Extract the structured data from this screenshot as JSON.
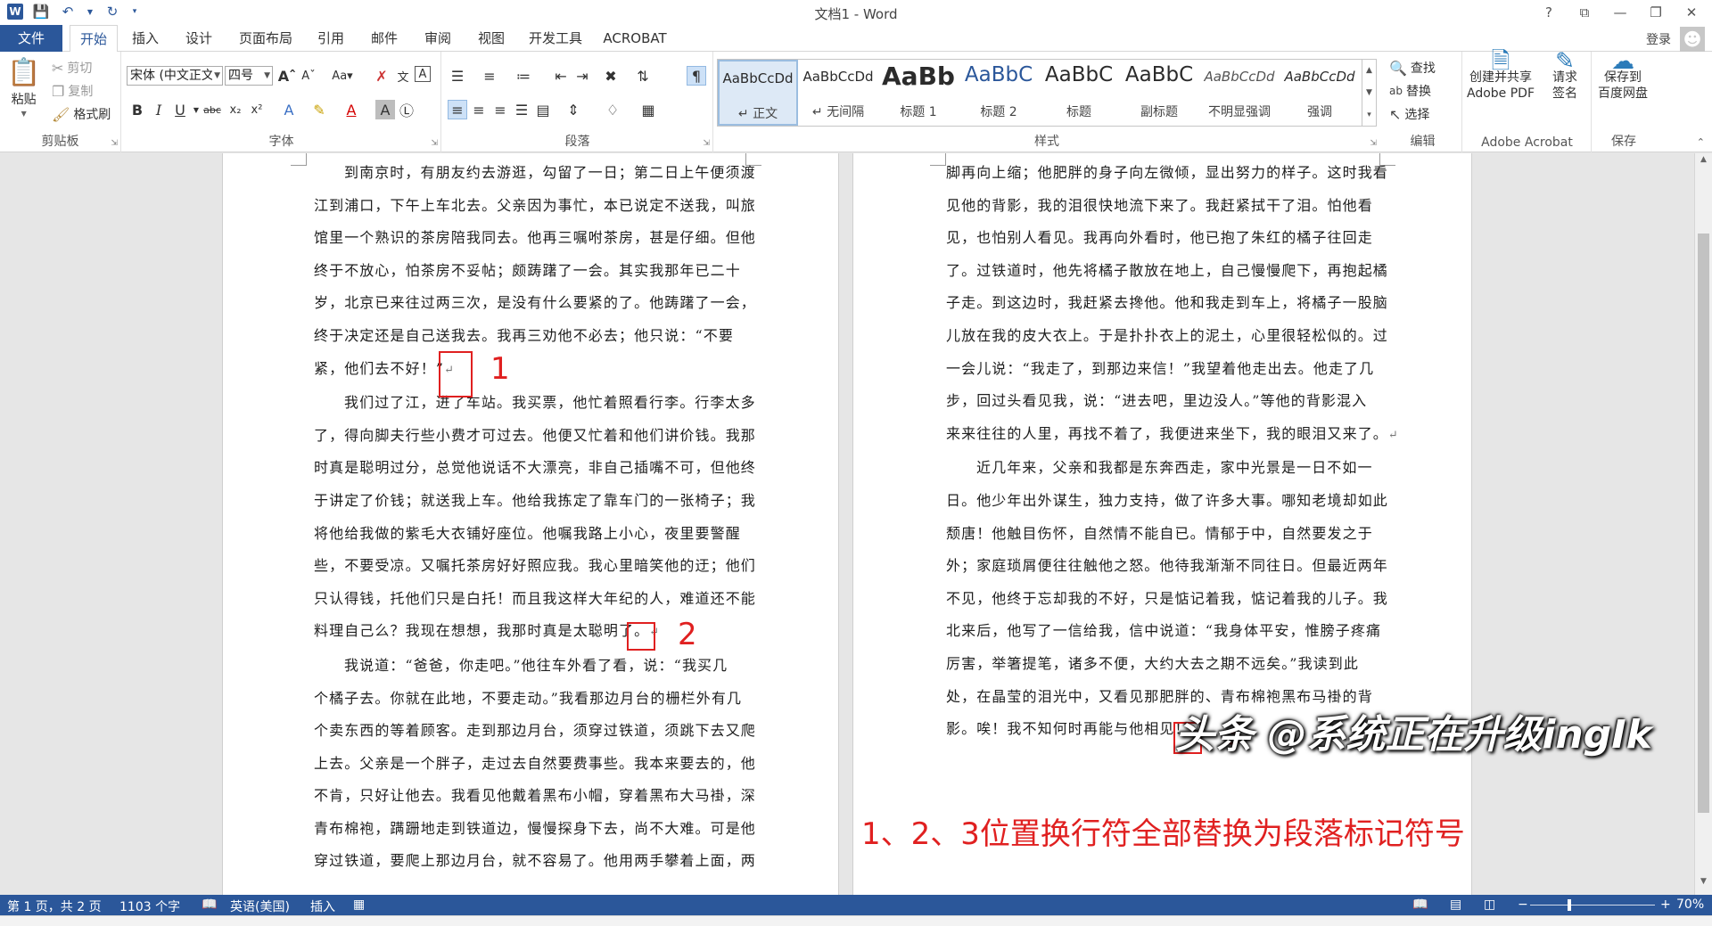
{
  "window": {
    "title": "文档1 - Word",
    "controls": [
      "?",
      "⧉",
      "—",
      "❐",
      "✕"
    ]
  },
  "qat": {
    "icons": [
      "word-icon",
      "save-icon",
      "undo-icon",
      "redo-icon",
      "customize-icon"
    ]
  },
  "tabs": [
    "文件",
    "开始",
    "插入",
    "设计",
    "页面布局",
    "引用",
    "邮件",
    "审阅",
    "视图",
    "开发工具",
    "ACROBAT"
  ],
  "active_tab": "开始",
  "user": {
    "signin": "登录"
  },
  "ribbon": {
    "clipboard": {
      "paste": "粘贴",
      "cut": "剪切",
      "copy": "复制",
      "format_painter": "格式刷",
      "label": "剪贴板"
    },
    "font": {
      "font_name": "宋体 (中文正文)",
      "font_size": "四号",
      "label": "字体"
    },
    "paragraph": {
      "label": "段落"
    },
    "styles": {
      "label": "样式",
      "items": [
        {
          "sample": "AaBbCcDd",
          "name": "↵ 正文"
        },
        {
          "sample": "AaBbCcDd",
          "name": "↵ 无间隔"
        },
        {
          "sample": "AaBb",
          "name": "标题 1"
        },
        {
          "sample": "AaBbC",
          "name": "标题 2"
        },
        {
          "sample": "AaBbC",
          "name": "标题"
        },
        {
          "sample": "AaBbC",
          "name": "副标题"
        },
        {
          "sample": "AaBbCcDd",
          "name": "不明显强调"
        },
        {
          "sample": "AaBbCcDd",
          "name": "强调"
        }
      ]
    },
    "editing": {
      "find": "查找",
      "replace": "替换",
      "select": "选择",
      "label": "编辑"
    },
    "acrobat": {
      "create_pdf_line1": "创建并共享",
      "create_pdf_line2": "Adobe PDF",
      "sign_line1": "请求",
      "sign_line2": "签名",
      "label": "Adobe Acrobat"
    },
    "save": {
      "line1": "保存到",
      "line2": "百度网盘",
      "label": "保存"
    }
  },
  "document": {
    "page1_lines": [
      "到南京时，有朋友约去游逛，勾留了一日；第二日上午便须渡",
      "江到浦口，下午上车北去。父亲因为事忙，本已说定不送我，叫旅",
      "馆里一个熟识的茶房陪我同去。他再三嘱咐茶房，甚是仔细。但他",
      "终于不放心，怕茶房不妥帖；颇踌躇了一会。其实我那年已二十",
      "岁，北京已来往过两三次，是没有什么要紧的了。他踌躇了一会，",
      "终于决定还是自己送我去。我再三劝他不必去；他只说：“不要",
      "紧，他们去不好！”",
      "我们过了江，进了车站。我买票，他忙着照看行李。行李太多",
      "了，得向脚夫行些小费才可过去。他便又忙着和他们讲价钱。我那",
      "时真是聪明过分，总觉他说话不大漂亮，非自己插嘴不可，但他终",
      "于讲定了价钱；就送我上车。他给我拣定了靠车门的一张椅子；我",
      "将他给我做的紫毛大衣铺好座位。他嘱我路上小心，夜里要警醒",
      "些，不要受凉。又嘱托茶房好好照应我。我心里暗笑他的迂；他们",
      "只认得钱，托他们只是白托！而且我这样大年纪的人，难道还不能",
      "料理自己么？我现在想想，我那时真是太聪明了。",
      "我说道：“爸爸，你走吧。”他往车外看了看，说：“我买几",
      "个橘子去。你就在此地，不要走动。”我看那边月台的栅栏外有几",
      "个卖东西的等着顾客。走到那边月台，须穿过铁道，须跳下去又爬",
      "上去。父亲是一个胖子，走过去自然要费事些。我本来要去的，他",
      "不肯，只好让他去。我看见他戴着黑布小帽，穿着黑布大马褂，深",
      "青布棉袍，蹒跚地走到铁道边，慢慢探身下去，尚不大难。可是他",
      "穿过铁道，要爬上那边月台，就不容易了。他用两手攀着上面，两"
    ],
    "page2_lines": [
      "脚再向上缩；他肥胖的身子向左微倾，显出努力的样子。这时我看",
      "见他的背影，我的泪很快地流下来了。我赶紧拭干了泪。怕他看",
      "见，也怕别人看见。我再向外看时，他已抱了朱红的橘子往回走",
      "了。过铁道时，他先将橘子散放在地上，自己慢慢爬下，再抱起橘",
      "子走。到这边时，我赶紧去搀他。他和我走到车上，将橘子一股脑",
      "儿放在我的皮大衣上。于是扑扑衣上的泥土，心里很轻松似的。过",
      "一会儿说：“我走了，到那边来信！”我望着他走出去。他走了几",
      "步，回过头看见我，说：“进去吧，里边没人。”等他的背影混入",
      "来来往往的人里，再找不着了，我便进来坐下，我的眼泪又来了。",
      "近几年来，父亲和我都是东奔西走，家中光景是一日不如一",
      "日。他少年出外谋生，独力支持，做了许多大事。哪知老境却如此",
      "颓唐！他触目伤怀，自然情不能自已。情郁于中，自然要发之于",
      "外；家庭琐屑便往往触他之怒。他待我渐渐不同往日。但最近两年",
      "不见，他终于忘却我的不好，只是惦记着我，惦记着我的儿子。我",
      "北来后，他写了一信给我，信中说道：“我身体平安，惟膀子疼痛",
      "厉害，举箸提笔，诸多不便，大约大去之期不远矣。”我读到此",
      "处，在晶莹的泪光中，又看见那肥胖的、青布棉袍黑布马褂的背",
      "影。唉！我不知何时再能与他相见！"
    ],
    "pilcrow": "↵",
    "markers": [
      "1",
      "2",
      "3"
    ],
    "note": "1、2、3位置换行符全部替换为段落标记符号",
    "watermark": "头条 @系统正在升级ingIk"
  },
  "status": {
    "page": "第 1 页，共 2 页",
    "words": "1103 个字",
    "language": "英语(美国)",
    "mode": "插入",
    "zoom": "70%",
    "zoom_value": 0.7
  }
}
